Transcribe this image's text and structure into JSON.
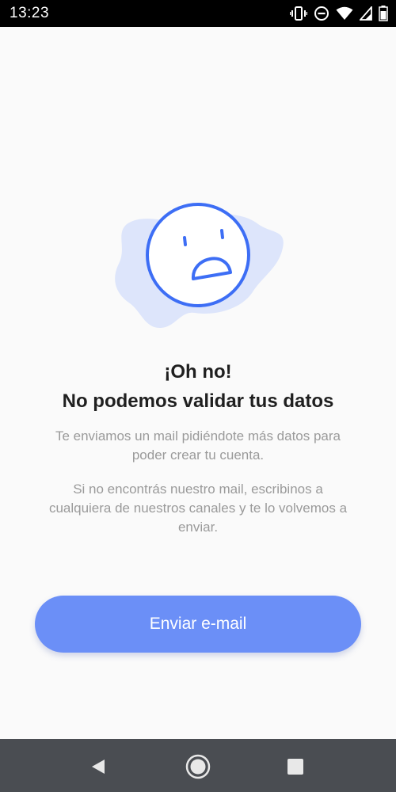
{
  "status_bar": {
    "time": "13:23",
    "icons": [
      "vibrate-icon",
      "do-not-disturb-icon",
      "wifi-icon",
      "signal-icon",
      "battery-icon"
    ]
  },
  "illustration": {
    "name": "sad-face-icon",
    "face_color": "#3d6ef5",
    "blob_color": "#dde5fb"
  },
  "title": {
    "line1": "¡Oh no!",
    "line2": "No podemos validar tus datos"
  },
  "body": {
    "paragraph1_line1": "Te enviamos un mail pidiéndote más datos para",
    "paragraph1_line2": "poder crear tu cuenta.",
    "paragraph2_line1": "Si no encontrás nuestro mail, escribinos a",
    "paragraph2_line2": "cualquiera de nuestros canales y te lo volvemos a",
    "paragraph2_line3": "enviar."
  },
  "button": {
    "label": "Enviar e-mail",
    "color": "#6b8ff7"
  },
  "nav_bar": {
    "icons": [
      "back-icon",
      "home-icon",
      "recents-icon"
    ]
  }
}
